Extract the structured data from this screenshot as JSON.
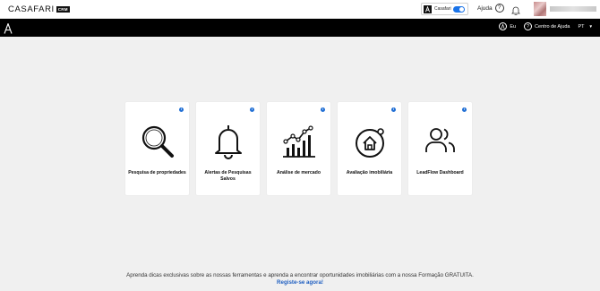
{
  "header": {
    "logo_text": "CASAFARI",
    "logo_badge": "CRM",
    "switcher_label": "Casafari",
    "help_label": "Ajuda"
  },
  "nav": {
    "me_label": "Eu",
    "help_center_label": "Centro de Ajuda",
    "language": "PT"
  },
  "cards": [
    {
      "label": "Pesquisa de propriedades",
      "icon": "magnifier-icon"
    },
    {
      "label": "Alertas de Pesquisas Salvos",
      "icon": "bell-icon"
    },
    {
      "label": "Análise de mercado",
      "icon": "bar-chart-icon"
    },
    {
      "label": "Avaliação imobiliária",
      "icon": "house-valuation-icon"
    },
    {
      "label": "LeadFlow Dashboard",
      "icon": "users-icon"
    }
  ],
  "promo": {
    "text": "Aprenda dicas exclusivas sobre as nossas ferramentas e aprenda a encontrar oportunidades imobiliárias com a nossa Formação GRATUITA.",
    "link": "Registe-se agora!"
  },
  "colors": {
    "accent": "#1f6ed4",
    "navbar": "#000000",
    "background": "#f0f0f0"
  }
}
